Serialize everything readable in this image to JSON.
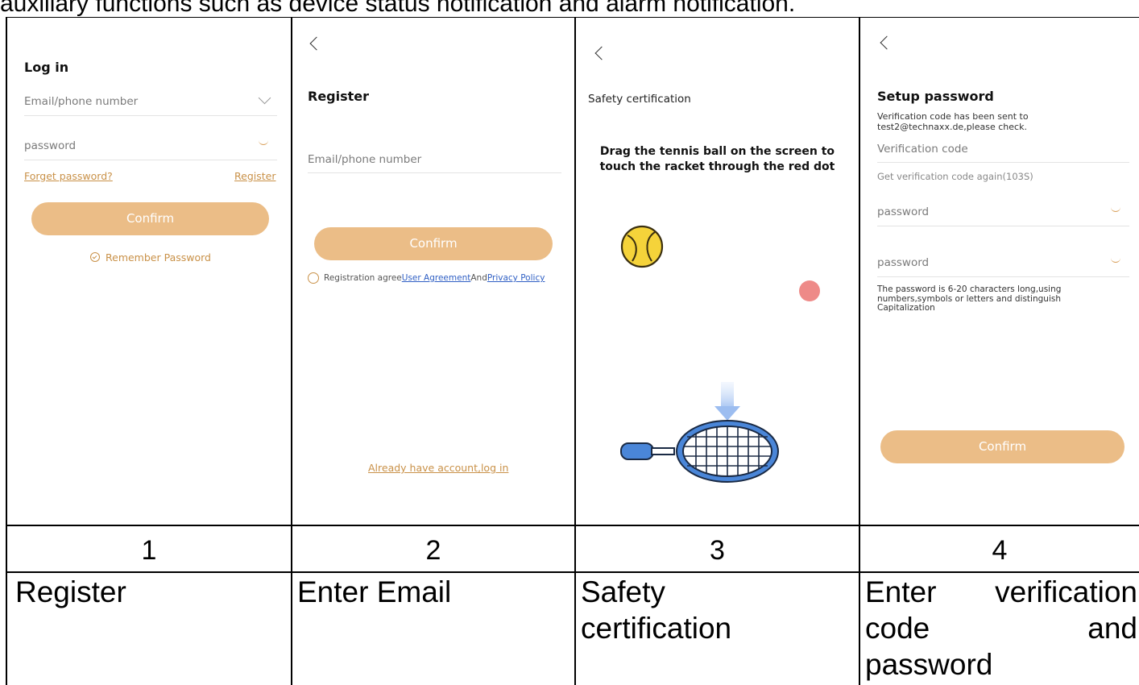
{
  "top_caption": "auxiliary functions such as device status notification and alarm notification.",
  "screens": [
    {
      "number": "1",
      "caption": "Register",
      "title": "Log in",
      "email_placeholder": "Email/phone number",
      "password_placeholder": "password",
      "forget_link": "Forget password?",
      "register_link": "Register",
      "confirm_label": "Confirm",
      "remember_label": "Remember Password"
    },
    {
      "number": "2",
      "caption": "Enter Email",
      "title": "Register",
      "email_placeholder": "Email/phone number",
      "confirm_label": "Confirm",
      "agree_prefix": "Registration agree",
      "user_agreement": "User Agreement",
      "and_text": "And",
      "privacy_policy": "Privacy Policy",
      "login_link": "Already have account,log in"
    },
    {
      "number": "3",
      "caption": "Safety certification",
      "title": "Safety certification",
      "instruction_line1": "Drag the tennis ball on the screen to",
      "instruction_line2": "touch the racket through the red dot"
    },
    {
      "number": "4",
      "caption_line1_a": "Enter",
      "caption_line1_b": "verification",
      "caption_line2_a": "code",
      "caption_line2_b": "and",
      "caption_line3": "password",
      "title": "Setup password",
      "sent_line1": "Verification code has been sent to",
      "sent_line2": "test2@technaxx.de,please check.",
      "code_placeholder": "Verification code",
      "resend_text": "Get verification code again(103S)",
      "password_placeholder_1": "password",
      "password_placeholder_2": "password",
      "rule_line1": "The password is 6-20 characters long,using",
      "rule_line2": "numbers,symbols or letters and distinguish",
      "rule_line3": "Capitalization",
      "confirm_label": "Confirm"
    }
  ],
  "colors": {
    "accent": "#ebbd87",
    "link_orange": "#c99148",
    "link_blue": "#2f5fc4",
    "ball_yellow": "#f5d33a",
    "red_dot": "#ee8a88",
    "racket_blue": "#4a86d8"
  }
}
